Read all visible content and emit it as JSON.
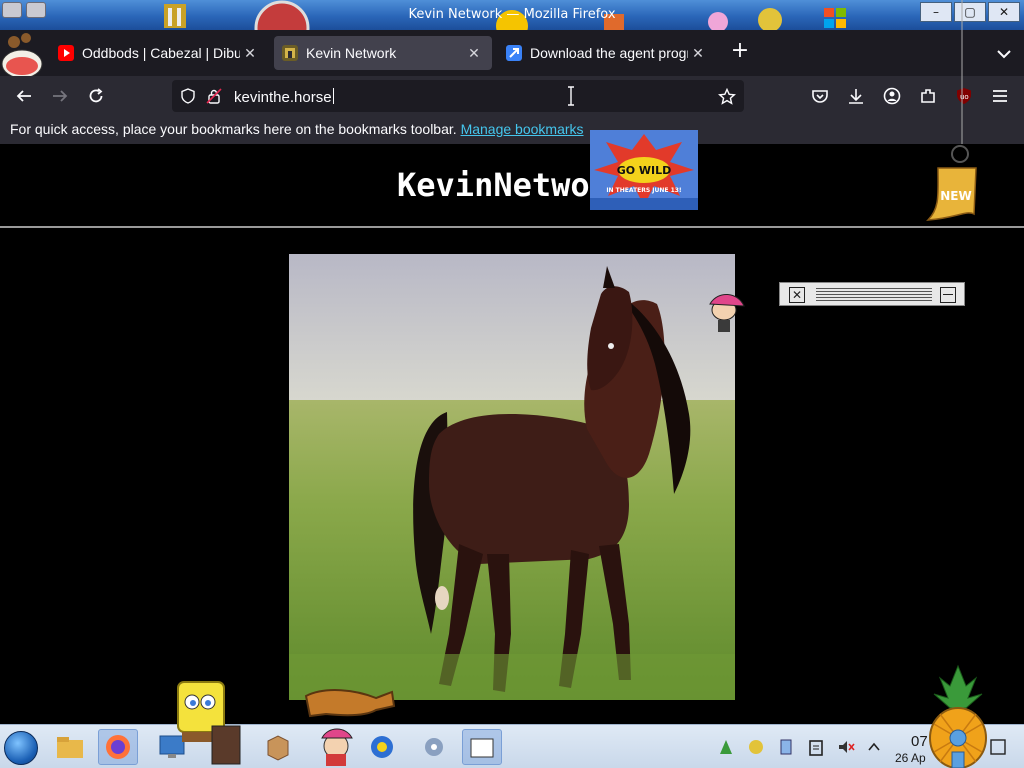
{
  "window": {
    "title": "Kevin Network — Mozilla Firefox",
    "controls": [
      "–",
      "▢",
      "✕"
    ]
  },
  "tabs": [
    {
      "label": "Oddbods | Cabezal | Dibujos",
      "favicon": "youtube-icon",
      "favicon_color": "#ff0000",
      "active": false
    },
    {
      "label": "Kevin Network",
      "favicon": "kevin-network-icon",
      "favicon_color": "#d4b44a",
      "active": true
    },
    {
      "label": "Download the agent program",
      "favicon": "arrow-link-icon",
      "favicon_color": "#3a82f7",
      "active": false
    }
  ],
  "toolbar": {
    "new_tab_label": "+",
    "url": "kevinthe.horse"
  },
  "bookmarks_bar": {
    "message": "For quick access, place your bookmarks here on the bookmarks toolbar.",
    "manage_link": "Manage bookmarks"
  },
  "page": {
    "site_title": "KevinNetwork",
    "ad_text": {
      "tagline": "IN THEATERS JUNE 13!",
      "headline": "GO WILD"
    },
    "new_badge": "NEW",
    "horse_alt": "bay horse standing in a grassy field"
  },
  "taskbar": {
    "time": "07",
    "date": "26 Ap",
    "apps": [
      "file-manager-icon",
      "firefox-icon",
      "system-monitor-icon",
      "package-icon",
      "media-icon",
      "settings-icon",
      "folder-icon"
    ]
  },
  "colors": {
    "tab_strip": "#1c1b22",
    "toolbar": "#2b2a33",
    "active_tab": "#42414d",
    "link": "#45c6ed",
    "taskbar": "#cfdcec"
  }
}
